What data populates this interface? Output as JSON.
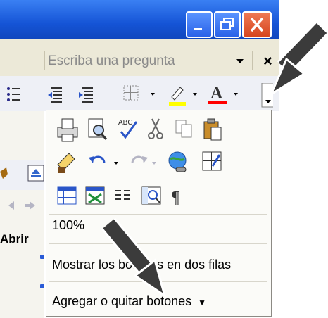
{
  "window": {
    "minimize_icon": "minimize-icon",
    "restore_icon": "restore-icon",
    "close_icon": "close-icon",
    "title_color": "#1554d6"
  },
  "menubar": {
    "ask_placeholder": "Escriba una pregunta",
    "close_glyph": "×"
  },
  "overflow_menu": {
    "zoom_value": "100%",
    "show_two_rows": "Mostrar los botones en dos filas",
    "add_remove": "Agregar o quitar botones"
  },
  "doc": {
    "visible_text": "Abrir"
  },
  "colors": {
    "highlight_yellow": "#ffff00",
    "font_red": "#ff0000",
    "annotation_arrow": "#3b3b3b"
  }
}
